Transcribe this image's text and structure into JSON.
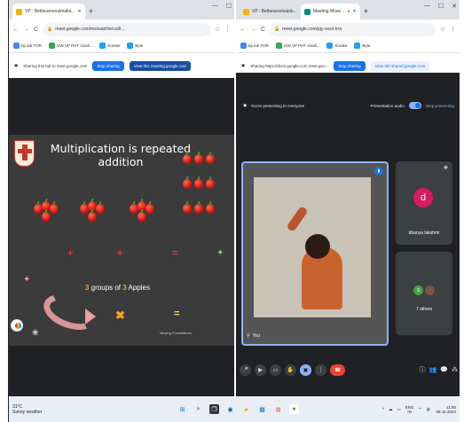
{
  "left_window": {
    "tab_title": "VP : Betbearsonolmalla...",
    "url": "meet.google.com/ms/watche/call/...",
    "bookmarks": [
      "bp lab FOR",
      "GW VP PHT sinall...",
      "Smake",
      "Byte",
      "Mnmgopmnoe"
    ],
    "share_text": "Sharing this tab to meet.google.com",
    "stop_sharing": "Stop sharing",
    "view_tab": "View this meeting.google.com",
    "slide": {
      "title": "Multiplication is repeated addition",
      "groups_prefix": "3",
      "groups_mid": " groups of ",
      "groups_num": "3",
      "groups_suffix": " Apples",
      "footer": "Varying Foundations"
    }
  },
  "right_window": {
    "tabs": [
      "VP : Betbearsolvable...",
      "Meeting Mose..."
    ],
    "url": "meet.google.com/pjy-xxxx-xxx",
    "bookmarks": [
      "bp lab FOR",
      "GW VP PHT sinall...",
      "Smake",
      "Byte",
      "Mnmgopmnoe"
    ],
    "share_text": "Sharing https://docs.google.com meet.goo...",
    "stop_sharing": "Stop sharing",
    "view_tab": "View tab shared google.com",
    "presenting_text": "You're presenting to everyone",
    "presentation_audio": "Presentation audio",
    "stop_presenting": "Stop presenting",
    "you_label": "You",
    "participant_initial": "d",
    "participant_name": "dhanya lakshmi",
    "others_count": "7 others",
    "others_avatar": "S"
  },
  "taskbar": {
    "weather_temp": "31°C",
    "weather_desc": "Sunny weather",
    "lang": "ENG",
    "lang_sub": "IN",
    "time": "11:00",
    "date": "05-11-2022"
  }
}
